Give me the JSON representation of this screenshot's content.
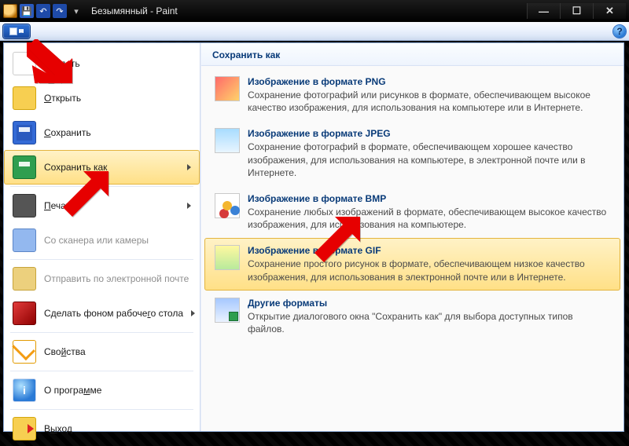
{
  "title": "Безымянный - Paint",
  "help_glyph": "?",
  "window_controls": {
    "min": "—",
    "max": "☐",
    "close": "✕"
  },
  "menu": {
    "new": {
      "glyph": "",
      "pre": "",
      "ul": "",
      "post": "Создать"
    },
    "open": {
      "pre": "",
      "ul": "О",
      "post": "ткрыть"
    },
    "save": {
      "pre": "",
      "ul": "С",
      "post": "охранить"
    },
    "saveas": {
      "pre": "Сохранить ",
      "ul": "к",
      "post": "ак"
    },
    "print": {
      "pre": "",
      "ul": "П",
      "post": "ечать"
    },
    "scan": {
      "label": "Со сканера или камеры"
    },
    "mail": {
      "label": "Отправить по электронной почте"
    },
    "desk": {
      "pre": "Сделать фоном рабоче",
      "ul": "г",
      "post": "о стола"
    },
    "props": {
      "pre": "Сво",
      "ul": "й",
      "post": "ства"
    },
    "about": {
      "pre": "О програ",
      "ul": "м",
      "post": "ме"
    },
    "exit": {
      "pre": "В",
      "ul": "ы",
      "post": "ход"
    }
  },
  "right_title": "Сохранить как",
  "formats": [
    {
      "id": "png",
      "title": "Изображение в формате PNG",
      "desc": "Сохранение фотографий или рисунков в формате, обеспечивающем высокое качество изображения, для использования на компьютере или в Интернете."
    },
    {
      "id": "jpeg",
      "title": "Изображение в формате JPEG",
      "desc": "Сохранение фотографий в формате, обеспечивающем хорошее качество изображения, для использования на компьютере, в электронной почте или в Интернете."
    },
    {
      "id": "bmp",
      "title": "Изображение в формате BMP",
      "desc": "Сохранение любых изображений в формате, обеспечивающем высокое качество изображения, для использования на компьютере."
    },
    {
      "id": "gif",
      "title": "Изображение в формате GIF",
      "desc": "Сохранение простого рисунок в формате, обеспечивающем низкое качество изображения, для использования в электронной почте или в Интернете.",
      "highlight": true
    },
    {
      "id": "other",
      "title": "Другие форматы",
      "desc": "Открытие диалогового окна \"Сохранить как\" для выбора доступных типов файлов."
    }
  ]
}
